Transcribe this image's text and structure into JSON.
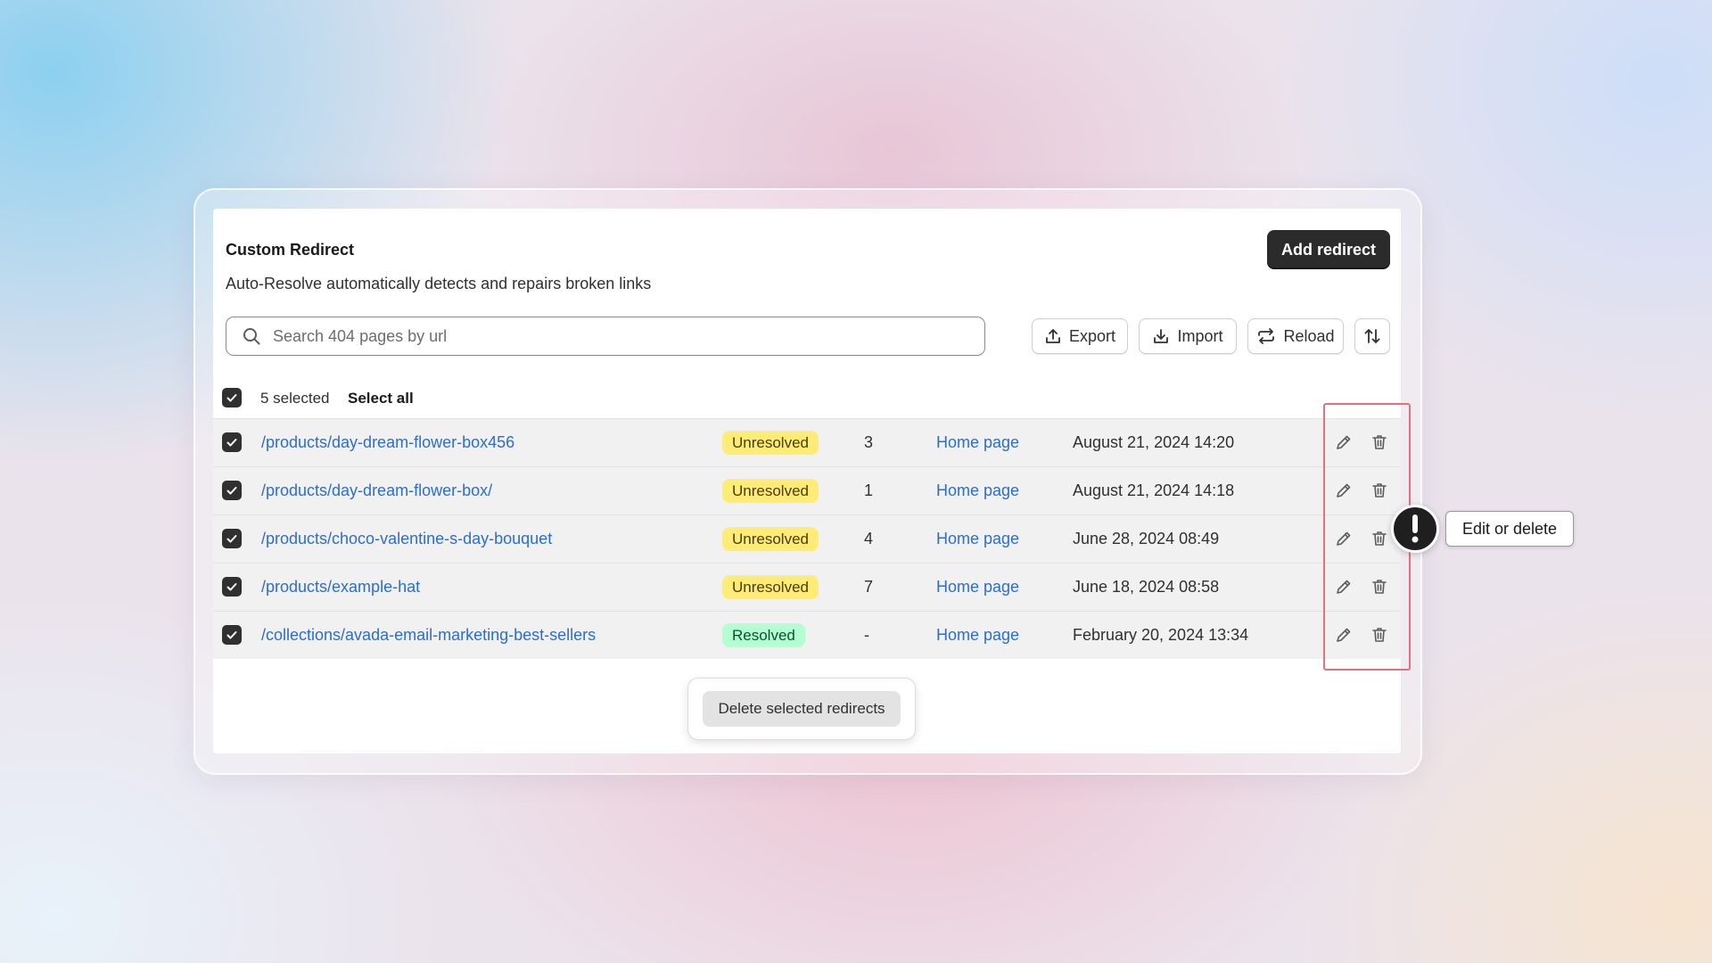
{
  "card": {
    "title": "Custom Redirect",
    "subtitle": "Auto-Resolve automatically detects and repairs broken links",
    "add_button_label": "Add redirect"
  },
  "search": {
    "placeholder": "Search 404 pages by url",
    "value": ""
  },
  "toolbar": {
    "export_label": "Export",
    "import_label": "Import",
    "reload_label": "Reload",
    "sort_icon": "sort-icon"
  },
  "selection": {
    "count_label": "5 selected",
    "select_all_label": "Select all",
    "checked": true
  },
  "rows": [
    {
      "url": "/products/day-dream-flower-box456",
      "status": "Unresolved",
      "hits": "3",
      "target": "Home page",
      "date": "August 21, 2024 14:20",
      "checked": true
    },
    {
      "url": "/products/day-dream-flower-box/",
      "status": "Unresolved",
      "hits": "1",
      "target": "Home page",
      "date": "August 21, 2024 14:18",
      "checked": true
    },
    {
      "url": "/products/choco-valentine-s-day-bouquet",
      "status": "Unresolved",
      "hits": "4",
      "target": "Home page",
      "date": "June 28, 2024 08:49",
      "checked": true
    },
    {
      "url": "/products/example-hat",
      "status": "Unresolved",
      "hits": "7",
      "target": "Home page",
      "date": "June 18, 2024 08:58",
      "checked": true
    },
    {
      "url": "/collections/avada-email-marketing-best-sellers",
      "status": "Resolved",
      "hits": "-",
      "target": "Home page",
      "date": "February 20, 2024 13:34",
      "checked": true
    }
  ],
  "callout": {
    "tooltip": "Edit or delete"
  },
  "bulk_actions": {
    "delete_label": "Delete selected redirects"
  },
  "colors": {
    "link": "#2c6ecb",
    "unresolved_badge": "#ffeb78",
    "resolved_badge": "#b4fed2",
    "primary_button": "#2b2b2b",
    "highlight": "#e8707a"
  }
}
